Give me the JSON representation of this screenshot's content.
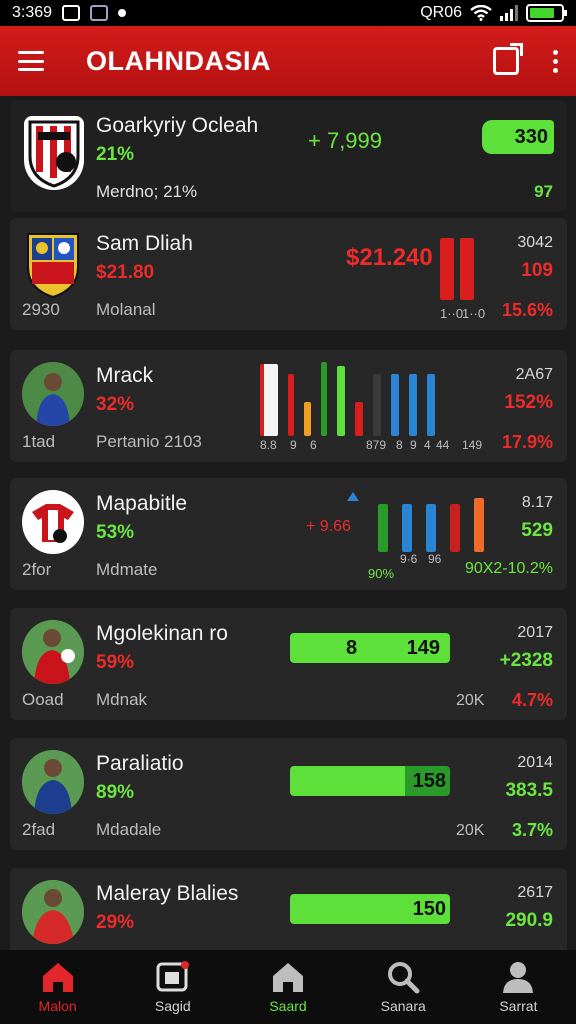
{
  "status": {
    "time": "3:369",
    "net": "QR06"
  },
  "appbar": {
    "title": "OLAHNDASIA"
  },
  "items": [
    {
      "name": "Goarkyriy Ocleah",
      "pct": "21%",
      "meta": "Merdno; 21%",
      "left": "",
      "mid": "+ 7,999",
      "pill": "330",
      "year": "",
      "val": "",
      "bot": "97"
    },
    {
      "name": "Sam Dliah",
      "pct": "$21.80",
      "meta": "Molanal",
      "left": "2930",
      "mid": "$21.240",
      "year": "3042",
      "val": "109",
      "bot": "15.6%",
      "bar_labels": [
        "1··0",
        "1··0"
      ]
    },
    {
      "name": "Mrack",
      "pct": "32%",
      "meta": "Pertanio 2103",
      "left": "1tad",
      "year": "2A67",
      "val": "152%",
      "bot": "17.9%",
      "bar_labels": [
        "8.8",
        "9",
        "6",
        "879",
        "8",
        "9",
        "4",
        "44",
        "149"
      ]
    },
    {
      "name": "Mapabitle",
      "pct": "53%",
      "meta": "Mdmate",
      "left": "2for",
      "mid": "+ 9.66",
      "year": "8.17",
      "val": "529",
      "bot": "90X2-10.2%",
      "bar_labels": [
        "90%",
        "9·6",
        "96"
      ]
    },
    {
      "name": "Mgolekinan ro",
      "pct": "59%",
      "meta": "Mdnak",
      "left": "Ooad",
      "pill_left": "8",
      "pill": "149",
      "year": "2017",
      "val": "+2328",
      "mid_bot": "20K",
      "bot": "4.7%"
    },
    {
      "name": "Paraliatio",
      "pct": "89%",
      "meta": "Mdadale",
      "left": "2fad",
      "pill": "158",
      "year": "2014",
      "val": "383.5",
      "mid_bot": "20K",
      "bot": "3.7%"
    },
    {
      "name": "Maleray Blalies",
      "pct": "29%",
      "meta": "",
      "left": "",
      "pill": "150",
      "year": "2617",
      "val": "290.9",
      "bot": ""
    }
  ],
  "nav": [
    "Malon",
    "Sagid",
    "Saard",
    "Sanara",
    "Sarrat"
  ],
  "colors": {
    "accent": "#d41b1b",
    "positive": "#6ce640",
    "negative": "#ee2b2b"
  },
  "icons": {
    "menu": "menu-icon",
    "share": "share-icon",
    "more": "more-vert-icon"
  }
}
